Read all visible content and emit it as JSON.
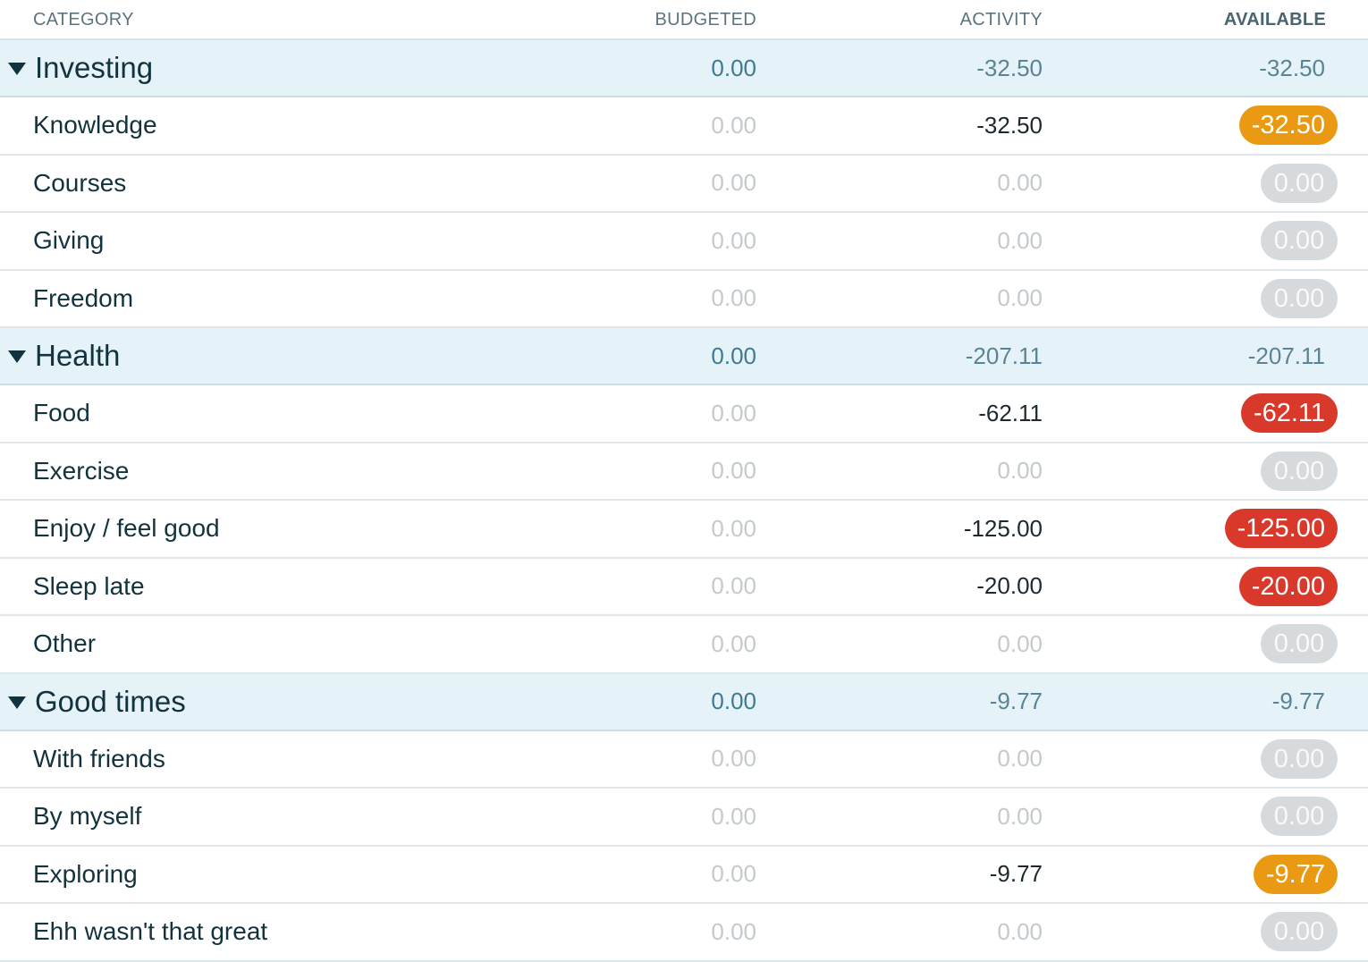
{
  "headers": {
    "category": "CATEGORY",
    "budgeted": "BUDGETED",
    "activity": "ACTIVITY",
    "available": "AVAILABLE"
  },
  "colors": {
    "group_background": "#e5f3f9",
    "pill_zero": "#d6dadc",
    "pill_warning": "#e99a12",
    "pill_overspent": "#d9392b"
  },
  "icons": {
    "collapse": "caret-down-icon"
  },
  "groups": [
    {
      "name": "Investing",
      "budgeted": "0.00",
      "activity": "-32.50",
      "available": "-32.50",
      "categories": [
        {
          "name": "Knowledge",
          "budgeted": "0.00",
          "activity": "-32.50",
          "available": "-32.50",
          "status": "warning"
        },
        {
          "name": "Courses",
          "budgeted": "0.00",
          "activity": "0.00",
          "available": "0.00",
          "status": "zero"
        },
        {
          "name": "Giving",
          "budgeted": "0.00",
          "activity": "0.00",
          "available": "0.00",
          "status": "zero"
        },
        {
          "name": "Freedom",
          "budgeted": "0.00",
          "activity": "0.00",
          "available": "0.00",
          "status": "zero"
        }
      ]
    },
    {
      "name": "Health",
      "budgeted": "0.00",
      "activity": "-207.11",
      "available": "-207.11",
      "categories": [
        {
          "name": "Food",
          "budgeted": "0.00",
          "activity": "-62.11",
          "available": "-62.11",
          "status": "overspent"
        },
        {
          "name": "Exercise",
          "budgeted": "0.00",
          "activity": "0.00",
          "available": "0.00",
          "status": "zero"
        },
        {
          "name": "Enjoy / feel good",
          "budgeted": "0.00",
          "activity": "-125.00",
          "available": "-125.00",
          "status": "overspent"
        },
        {
          "name": "Sleep late",
          "budgeted": "0.00",
          "activity": "-20.00",
          "available": "-20.00",
          "status": "overspent"
        },
        {
          "name": "Other",
          "budgeted": "0.00",
          "activity": "0.00",
          "available": "0.00",
          "status": "zero"
        }
      ]
    },
    {
      "name": "Good times",
      "budgeted": "0.00",
      "activity": "-9.77",
      "available": "-9.77",
      "categories": [
        {
          "name": "With friends",
          "budgeted": "0.00",
          "activity": "0.00",
          "available": "0.00",
          "status": "zero"
        },
        {
          "name": "By myself",
          "budgeted": "0.00",
          "activity": "0.00",
          "available": "0.00",
          "status": "zero"
        },
        {
          "name": "Exploring",
          "budgeted": "0.00",
          "activity": "-9.77",
          "available": "-9.77",
          "status": "warning"
        },
        {
          "name": "Ehh wasn't that great",
          "budgeted": "0.00",
          "activity": "0.00",
          "available": "0.00",
          "status": "zero"
        }
      ]
    }
  ]
}
